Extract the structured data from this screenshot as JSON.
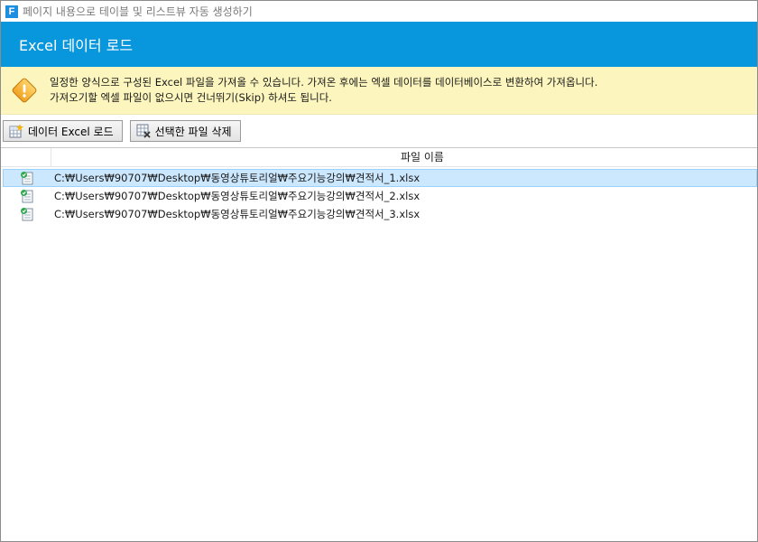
{
  "window": {
    "title": "페이지 내용으로 테이블 및 리스트뷰 자동 생성하기",
    "app_icon_letter": "F"
  },
  "header": {
    "title": "Excel 데이터 로드"
  },
  "notice": {
    "line1": "일정한 양식으로 구성된 Excel 파일을 가져올 수 있습니다. 가져온 후에는 엑셀 데이터를 데이터베이스로 변환하여 가져옵니다.",
    "line2": "가져오기할 엑셀 파일이 없으시면 건너뛰기(Skip) 하셔도 됩니다."
  },
  "toolbar": {
    "load_label": "데이터 Excel 로드",
    "delete_label": "선택한 파일 삭제"
  },
  "list": {
    "column_header": "파일 이름",
    "rows": [
      {
        "path": "C:₩Users₩90707₩Desktop₩동영상튜토리얼₩주요기능강의₩견적서_1.xlsx",
        "selected": true
      },
      {
        "path": "C:₩Users₩90707₩Desktop₩동영상튜토리얼₩주요기능강의₩견적서_2.xlsx",
        "selected": false
      },
      {
        "path": "C:₩Users₩90707₩Desktop₩동영상튜토리얼₩주요기능강의₩견적서_3.xlsx",
        "selected": false
      }
    ]
  },
  "colors": {
    "header_bg": "#0896dc",
    "notice_bg": "#fcf5bd",
    "selected_row": "#cce8ff"
  },
  "icons": {
    "app": "app-logo-icon",
    "warning": "warning-icon",
    "load": "excel-load-icon",
    "delete": "delete-file-icon",
    "file": "excel-file-icon"
  }
}
